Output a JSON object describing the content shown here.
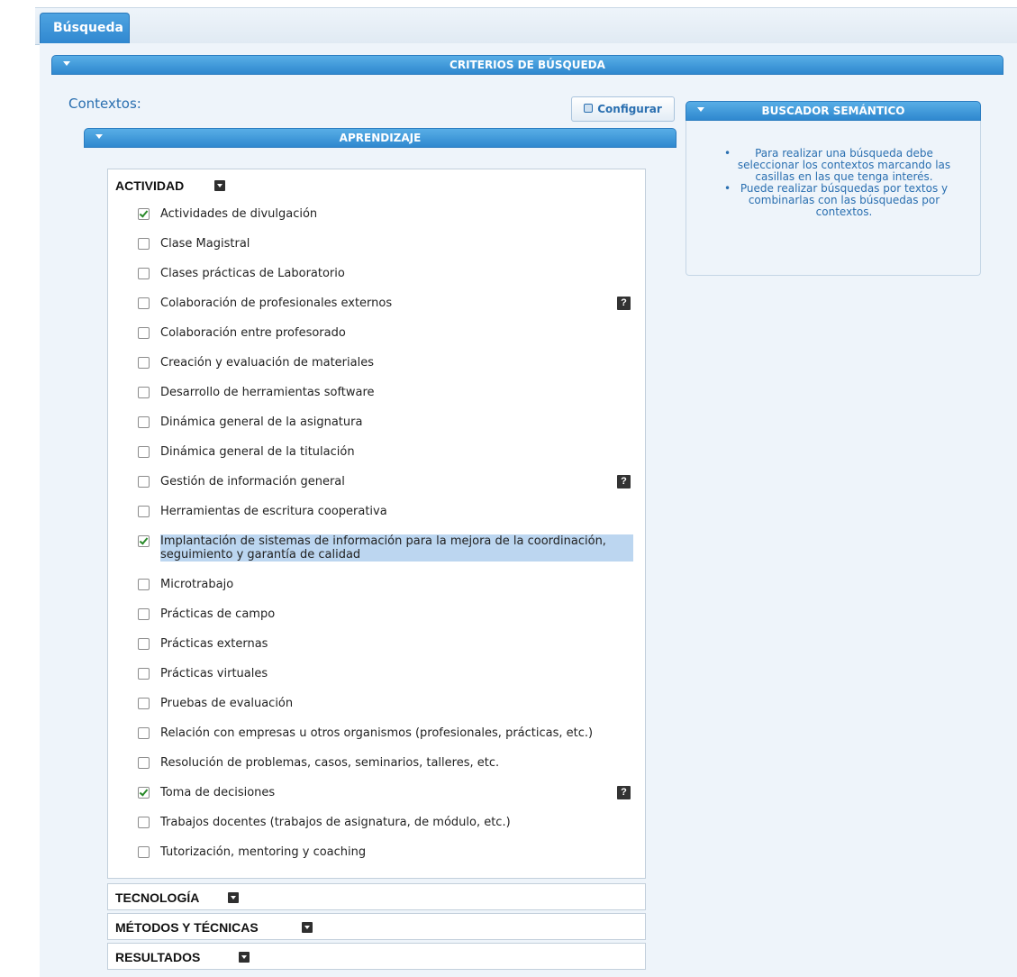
{
  "tabs": [
    {
      "label": "Búsqueda",
      "active": true
    }
  ],
  "criterios": {
    "title": "CRITERIOS DE BÚSQUEDA"
  },
  "contextos_label": "Contextos:",
  "configurar_button": {
    "label": "Configurar",
    "icon": "gear-icon"
  },
  "aprendizaje": {
    "title": "APRENDIZAJE"
  },
  "actividad": {
    "title": "ACTIVIDAD",
    "items": [
      {
        "label": "Actividades de divulgación",
        "checked": true,
        "help": false
      },
      {
        "label": "Clase Magistral",
        "checked": false,
        "help": false
      },
      {
        "label": "Clases prácticas de Laboratorio",
        "checked": false,
        "help": false
      },
      {
        "label": "Colaboración de profesionales externos",
        "checked": false,
        "help": true
      },
      {
        "label": "Colaboración entre profesorado",
        "checked": false,
        "help": false
      },
      {
        "label": "Creación y evaluación de materiales",
        "checked": false,
        "help": false
      },
      {
        "label": "Desarrollo de herramientas software",
        "checked": false,
        "help": false
      },
      {
        "label": "Dinámica general de la asignatura",
        "checked": false,
        "help": false
      },
      {
        "label": "Dinámica general de la titulación",
        "checked": false,
        "help": false
      },
      {
        "label": "Gestión de información general",
        "checked": false,
        "help": true
      },
      {
        "label": "Herramientas de escritura cooperativa",
        "checked": false,
        "help": false
      },
      {
        "label": "Implantación de sistemas de información para la mejora de la coordinación, seguimiento y garantía de calidad",
        "checked": true,
        "help": false,
        "selected": true
      },
      {
        "label": "Microtrabajo",
        "checked": false,
        "help": false
      },
      {
        "label": "Prácticas de campo",
        "checked": false,
        "help": false
      },
      {
        "label": "Prácticas externas",
        "checked": false,
        "help": false
      },
      {
        "label": "Prácticas virtuales",
        "checked": false,
        "help": false
      },
      {
        "label": "Pruebas de evaluación",
        "checked": false,
        "help": false
      },
      {
        "label": "Relación con empresas u otros organismos (profesionales, prácticas, etc.)",
        "checked": false,
        "help": false
      },
      {
        "label": "Resolución de problemas, casos, seminarios, talleres, etc.",
        "checked": false,
        "help": false
      },
      {
        "label": "Toma de decisiones",
        "checked": true,
        "help": true
      },
      {
        "label": "Trabajos docentes (trabajos de asignatura, de módulo, etc.)",
        "checked": false,
        "help": false
      },
      {
        "label": "Tutorización, mentoring y coaching",
        "checked": false,
        "help": false
      }
    ]
  },
  "collapsed_sections": [
    {
      "title": "TECNOLOGÍA"
    },
    {
      "title": "MÉTODOS Y TÉCNICAS"
    },
    {
      "title": "RESULTADOS"
    }
  ],
  "help_label": "?",
  "buscador": {
    "title": "BUSCADOR SEMÁNTICO",
    "tips": [
      "Para realizar una búsqueda debe seleccionar los contextos marcando las casillas en las que tenga interés.",
      "Puede realizar búsquedas por textos y combinarlas con las búsquedas por contextos."
    ]
  },
  "colors": {
    "accent": "#3a93d8",
    "link": "#2a6fb0",
    "background": "#eef4fa"
  }
}
